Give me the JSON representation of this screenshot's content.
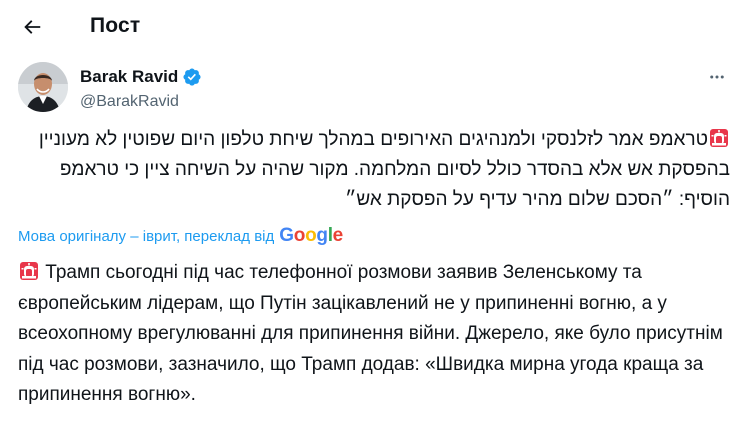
{
  "header": {
    "title": "Пост"
  },
  "author": {
    "name": "Barak Ravid",
    "handle": "@BarakRavid"
  },
  "tweet": {
    "original_text": "טראמפ אמר לזלנסקי ולמנהיגים האירופים במהלך שיחת טלפון היום שפוטין לא מעוניין בהפסקת אש אלא בהסדר כולל לסיום המלחמה. מקור שהיה על השיחה ציין כי טראמפ הוסיף: ״הסכם שלום מהיר עדיף על הפסקת אש״",
    "translate_label": "Мова оригіналу – іврит, переклад від",
    "translate_provider": "Google",
    "translated_text": "Трамп сьогодні під час телефонної розмови заявив Зеленському та європейським лідерам, що Путін зацікавлений не у припиненні вогню, а у всеохопному врегулюванні для припинення війни. Джерело, яке було присутнім під час розмови, зазначило, що Трамп додав: «Швидка мирна угода краща за припинення вогню»."
  },
  "icons": {
    "back": "arrow-left-icon",
    "verified": "verified-badge-icon",
    "more": "more-horizontal-icon",
    "siren": "police-light-emoji"
  },
  "colors": {
    "text": "#0f1419",
    "secondary": "#536471",
    "accent": "#1d9bf0",
    "siren": "#e8374b"
  }
}
